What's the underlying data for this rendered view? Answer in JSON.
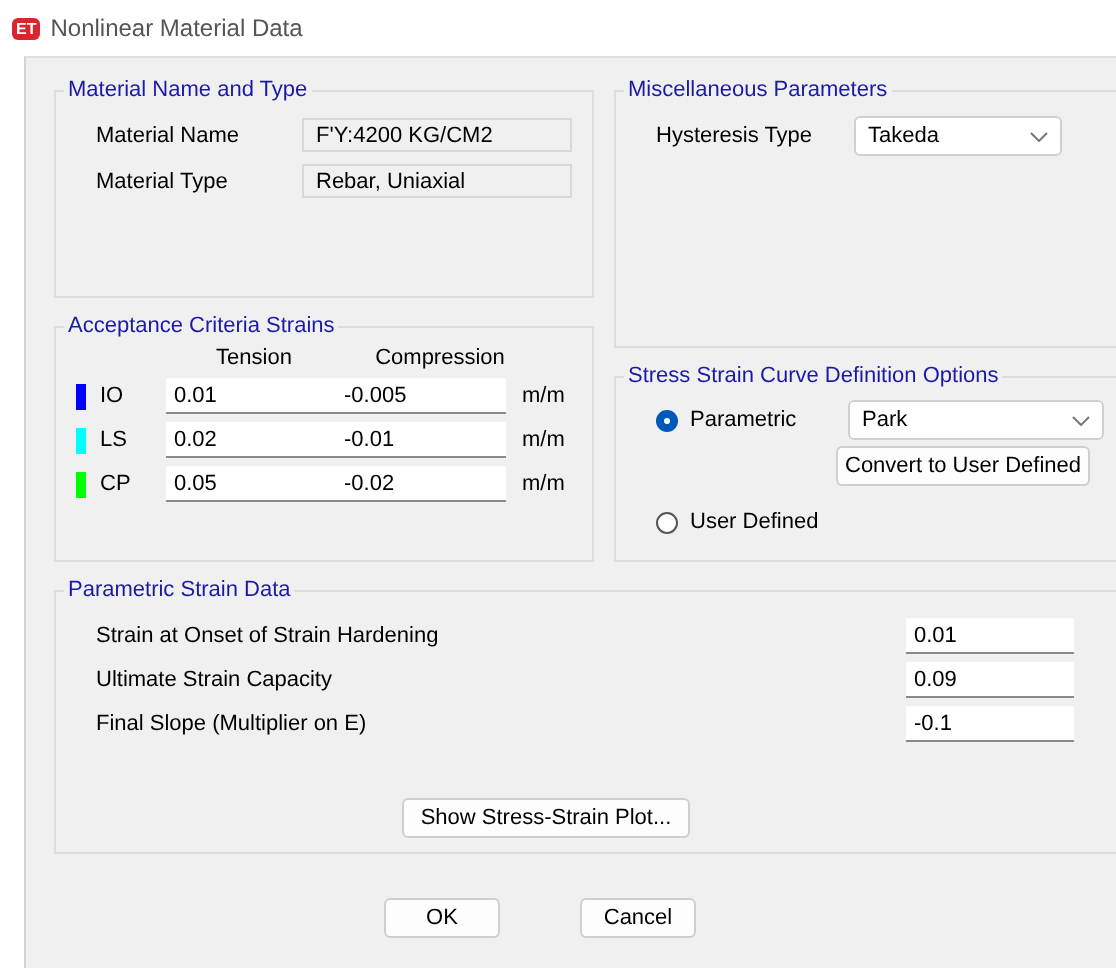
{
  "window": {
    "title": "Nonlinear Material Data",
    "app_icon": "ET"
  },
  "material": {
    "title": "Material Name and Type",
    "fields": [
      {
        "label": "Material Name",
        "value": "F'Y:4200 KG/CM2"
      },
      {
        "label": "Material Type",
        "value": "Rebar, Uniaxial"
      }
    ]
  },
  "acceptance": {
    "title": "Acceptance Criteria Strains",
    "columns": [
      "Tension",
      "Compression"
    ],
    "rows": [
      {
        "label": "IO",
        "color": "#0000ff",
        "tension": "0.01",
        "compression": "-0.005",
        "unit": "m/m"
      },
      {
        "label": "LS",
        "color": "#00ffff",
        "tension": "0.02",
        "compression": "-0.01",
        "unit": "m/m"
      },
      {
        "label": "CP",
        "color": "#00ff00",
        "tension": "0.05",
        "compression": "-0.02",
        "unit": "m/m"
      }
    ]
  },
  "misc": {
    "title": "Miscellaneous Parameters",
    "label": "Hysteresis Type",
    "value": "Takeda"
  },
  "curve": {
    "title": "Stress Strain Curve Definition Options",
    "options": [
      {
        "label": "Parametric",
        "selected": true
      },
      {
        "label": "User Defined",
        "selected": false
      }
    ],
    "dropdown": "Park",
    "convert_button": "Convert to User Defined"
  },
  "parametric": {
    "title": "Parametric Strain Data",
    "fields": [
      {
        "label": "Strain at Onset of Strain Hardening",
        "value": "0.01"
      },
      {
        "label": "Ultimate Strain Capacity",
        "value": "0.09"
      },
      {
        "label": "Final Slope (Multiplier on E)",
        "value": "-0.1"
      }
    ],
    "plot_button": "Show Stress-Strain Plot..."
  },
  "buttons": [
    "OK",
    "Cancel"
  ]
}
